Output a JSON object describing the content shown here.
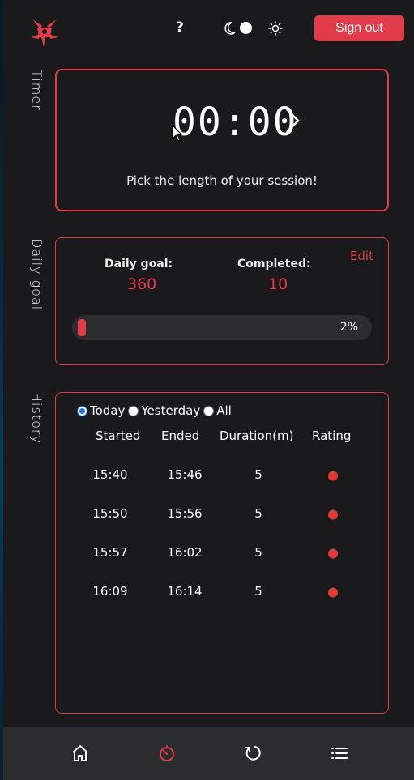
{
  "header": {
    "help_label": "?",
    "signout_label": "Sign out"
  },
  "sections": {
    "timer_title": "Timer",
    "goal_title": "Daily goal",
    "history_title": "History"
  },
  "timer": {
    "display": "00:00",
    "hint": "Pick the length of your session!"
  },
  "goal": {
    "edit_label": "Edit",
    "daily_goal_label": "Daily goal:",
    "daily_goal_value": "360",
    "completed_label": "Completed:",
    "completed_value": "10",
    "progress_text": "2%",
    "progress_fraction": 0.028
  },
  "history": {
    "filters": [
      "Today",
      "Yesterday",
      "All"
    ],
    "selected_filter": "Today",
    "columns": [
      "Started",
      "Ended",
      "Duration(m)",
      "Rating"
    ],
    "rows": [
      {
        "started": "15:40",
        "ended": "15:46",
        "duration": "5",
        "rating": "tomato-icon"
      },
      {
        "started": "15:50",
        "ended": "15:56",
        "duration": "5",
        "rating": "tomato-icon"
      },
      {
        "started": "15:57",
        "ended": "16:02",
        "duration": "5",
        "rating": "tomato-icon"
      },
      {
        "started": "16:09",
        "ended": "16:14",
        "duration": "5",
        "rating": "tomato-icon"
      }
    ]
  },
  "nav": {
    "items": [
      "home-icon",
      "timer-icon",
      "refresh-icon",
      "list-icon"
    ],
    "active": "timer-icon"
  },
  "colors": {
    "accent": "#e03c4a",
    "background": "#1a191b",
    "nav_background": "#2b2c2e"
  }
}
